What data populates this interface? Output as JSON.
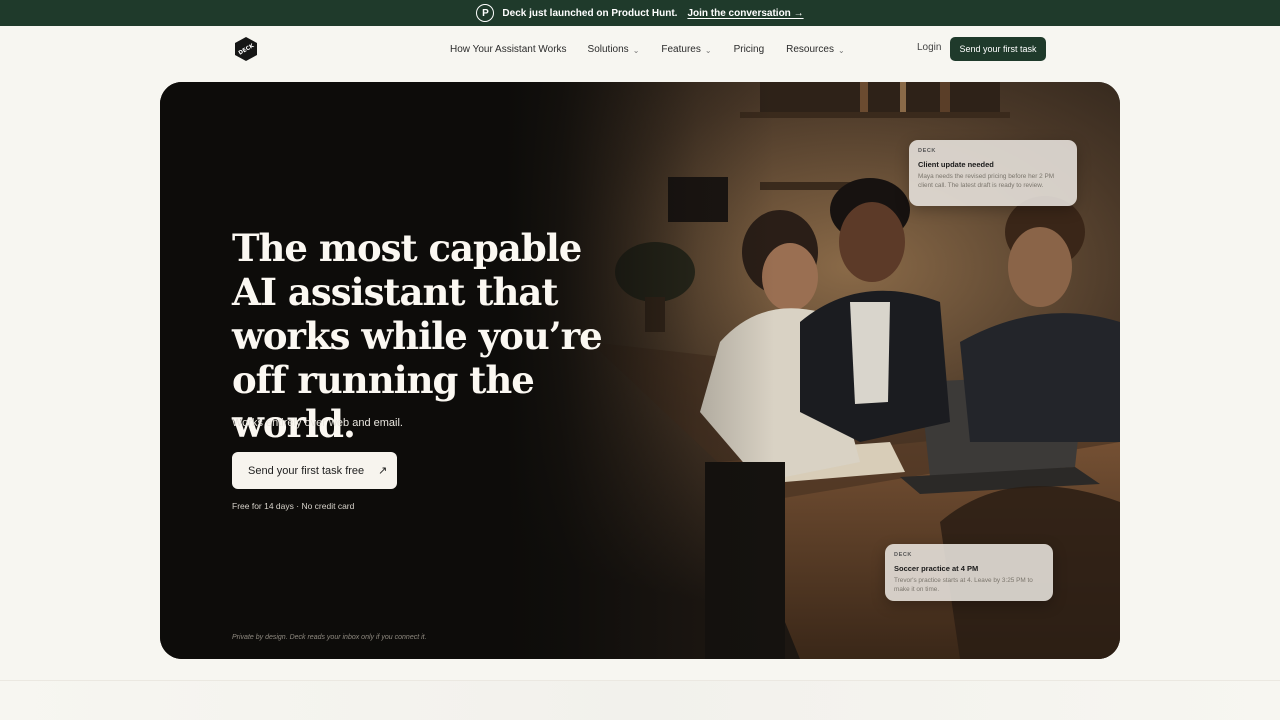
{
  "announcement": {
    "badge_letter": "P",
    "text": "Deck just launched on Product Hunt.",
    "link": "Join the conversation →"
  },
  "nav": {
    "logo_letters": "DECK",
    "links": [
      {
        "label": "How Your Assistant Works"
      },
      {
        "label": "Solutions"
      },
      {
        "label": "Features"
      },
      {
        "label": "Pricing"
      },
      {
        "label": "Resources"
      }
    ],
    "chevron": "⌄",
    "login": "Login",
    "cta": "Send your first task"
  },
  "hero": {
    "headline": "The most capable AI assistant that works while you’re off running the world.",
    "subline": "Works entirely over web and email.",
    "cta": "Send your first task free",
    "cta_icon": "↗",
    "fine_print": "Free for 14 days · No credit card",
    "privacy": "Private by design. Deck reads your inbox only if you connect it."
  },
  "notifications": [
    {
      "brand": "DECK",
      "title": "Client update needed",
      "body": "Maya needs the revised pricing before her 2 PM client call. The latest draft is ready to review."
    },
    {
      "brand": "DECK",
      "title": "Soccer practice at 4 PM",
      "body": "Trevor's practice starts at 4. Leave by 3:25 PM to make it on time."
    }
  ],
  "colors": {
    "brand_green": "#1f3a2b",
    "page_bg": "#f7f6f1",
    "hero_dark": "#0f0d0b"
  }
}
